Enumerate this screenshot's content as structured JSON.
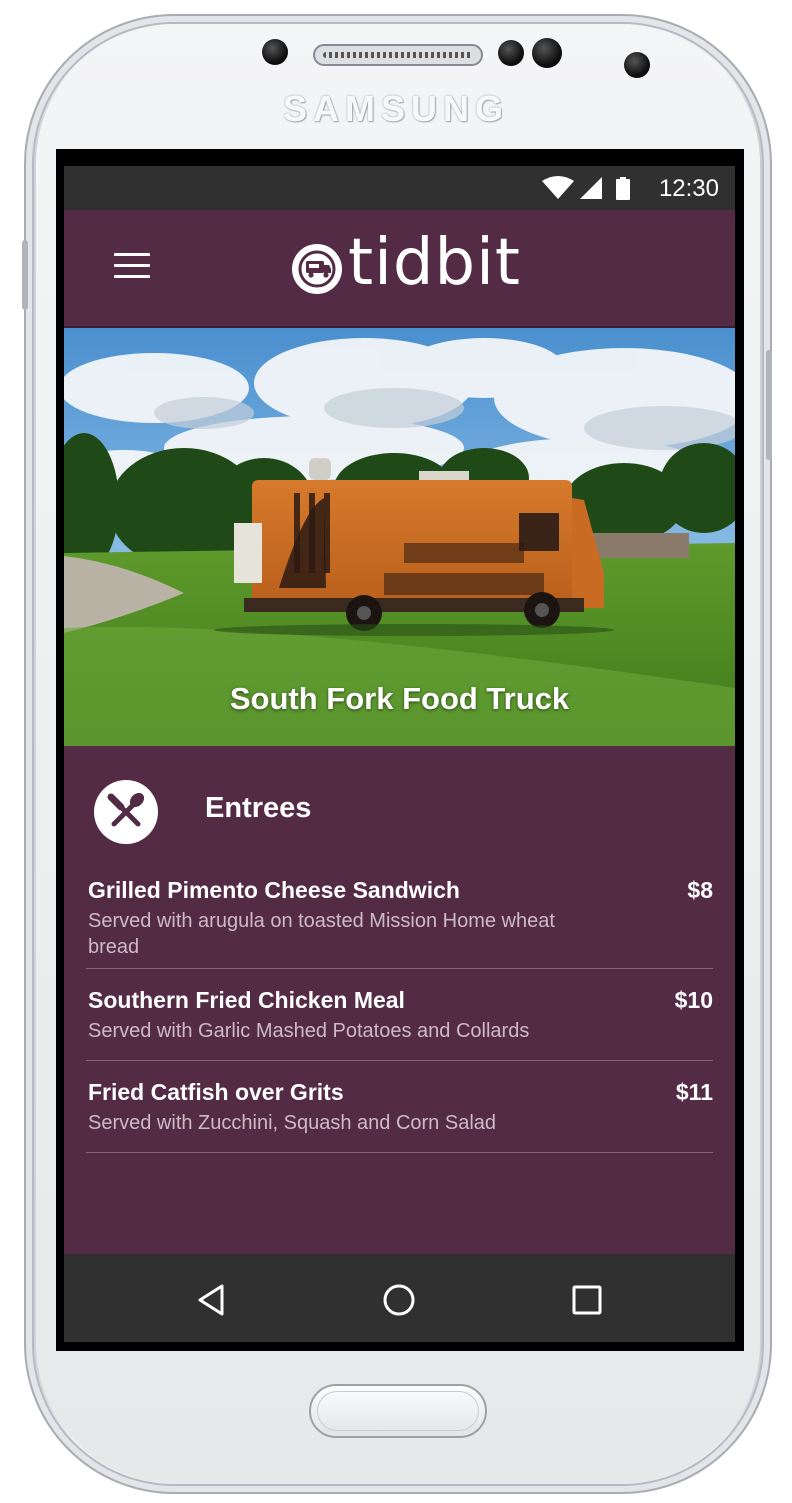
{
  "device": {
    "brand": "SAMSUNG"
  },
  "status_bar": {
    "time": "12:30",
    "icons": [
      "wifi-icon",
      "signal-icon",
      "battery-icon"
    ]
  },
  "app_bar": {
    "menu_icon": "hamburger-menu-icon",
    "logo_icon": "food-truck-icon",
    "logo_text": "tidbit"
  },
  "hero": {
    "title": "South Fork Food Truck"
  },
  "menu": {
    "section_icon": "fork-knife-icon",
    "section_title": "Entrees",
    "items": [
      {
        "name": "Grilled Pimento Cheese Sandwich",
        "description": "Served with arugula on toasted Mission Home wheat bread",
        "price": "$8"
      },
      {
        "name": "Southern Fried Chicken Meal",
        "description": "Served with Garlic Mashed Potatoes and Collards",
        "price": "$10"
      },
      {
        "name": "Fried Catfish over Grits",
        "description": "Served with Zucchini, Squash and Corn Salad",
        "price": "$11"
      }
    ]
  },
  "nav_bar": {
    "buttons": [
      "back-icon",
      "home-icon",
      "recents-icon"
    ]
  },
  "colors": {
    "primary": "#542b44",
    "system_bar": "#303030",
    "text": "#ffffff",
    "secondary_text": "#cdbac6"
  }
}
